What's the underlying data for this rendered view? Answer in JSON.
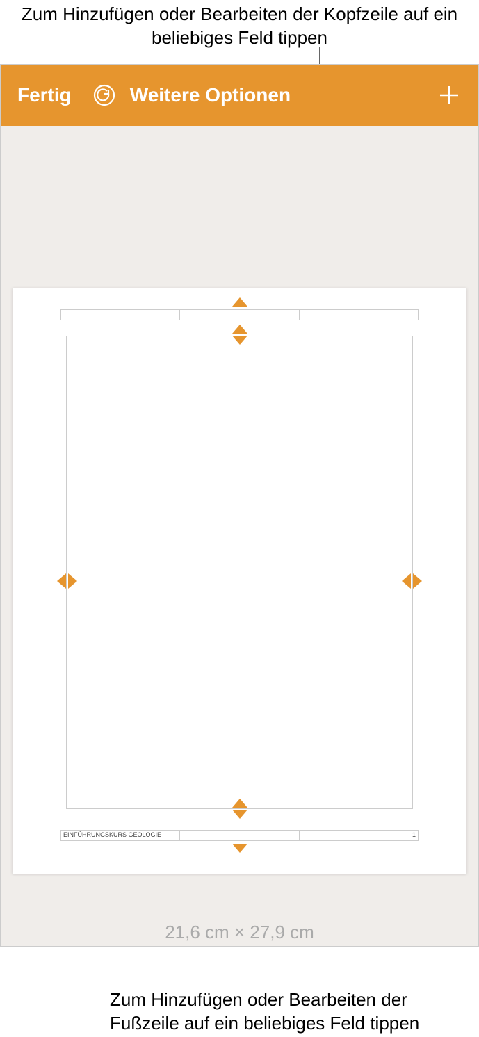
{
  "callouts": {
    "top": "Zum Hinzufügen oder Bearbeiten der Kopfzeile auf ein beliebiges Feld tippen",
    "bottom": "Zum Hinzufügen oder Bearbeiten der Fußzeile auf ein beliebiges Feld tippen"
  },
  "toolbar": {
    "done": "Fertig",
    "options": "Weitere Optionen"
  },
  "page": {
    "header": {
      "left": "",
      "center": "",
      "right": ""
    },
    "footer": {
      "left": "EINFÜHRUNGSKURS GEOLOGIE",
      "center": "",
      "right": "1"
    },
    "dimensions": "21,6 cm × 27,9 cm"
  },
  "colors": {
    "accent": "#e6952e"
  }
}
